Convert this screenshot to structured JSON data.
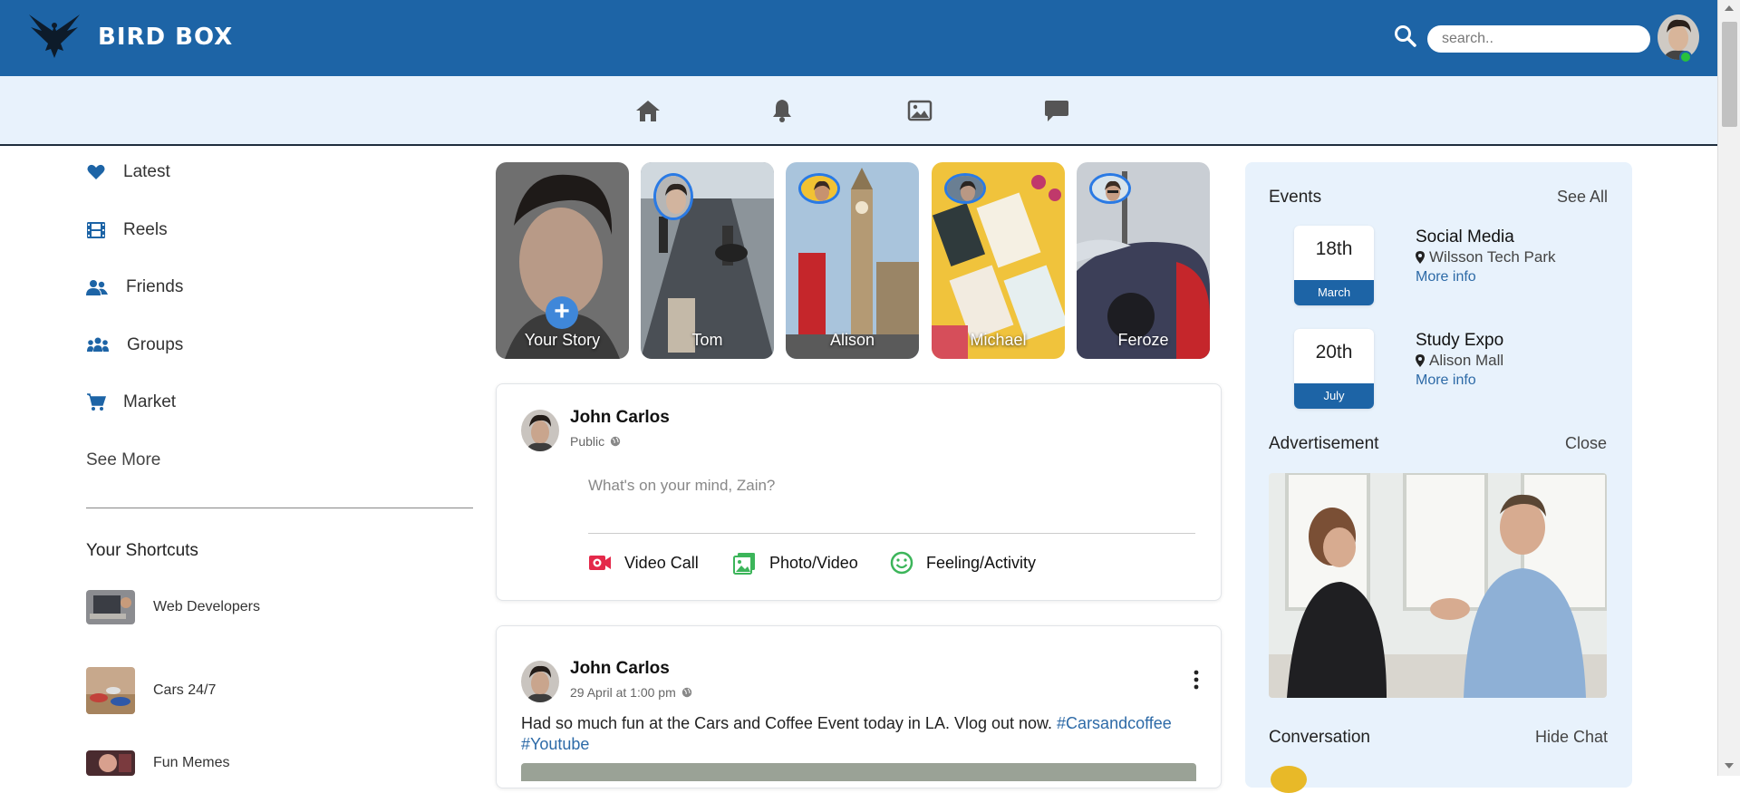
{
  "header": {
    "brand": "BIRD BOX",
    "search_placeholder": "search.."
  },
  "nav": {
    "items": [
      "home-icon",
      "bell-icon",
      "image-icon",
      "chat-icon"
    ]
  },
  "sidebar": {
    "items": [
      {
        "label": "Latest",
        "icon": "heart-icon"
      },
      {
        "label": "Reels",
        "icon": "film-icon"
      },
      {
        "label": "Friends",
        "icon": "users-icon"
      },
      {
        "label": "Groups",
        "icon": "group-icon"
      },
      {
        "label": "Market",
        "icon": "cart-icon"
      }
    ],
    "see_more": "See More",
    "shortcuts_title": "Your Shortcuts",
    "shortcuts": [
      {
        "label": "Web Developers"
      },
      {
        "label": "Cars 24/7"
      },
      {
        "label": "Fun Memes"
      }
    ]
  },
  "stories": [
    {
      "name": "Your Story"
    },
    {
      "name": "Tom"
    },
    {
      "name": "Alison"
    },
    {
      "name": "Michael"
    },
    {
      "name": "Feroze"
    }
  ],
  "composer": {
    "author": "John Carlos",
    "visibility": "Public",
    "placeholder": "What's on your mind, Zain?",
    "actions": [
      {
        "label": "Video Call",
        "icon": "video-icon",
        "color": "#e4294a"
      },
      {
        "label": "Photo/Video",
        "icon": "photo-icon",
        "color": "#3cb55a"
      },
      {
        "label": "Feeling/Activity",
        "icon": "smile-icon",
        "color": "#3cb55a"
      }
    ]
  },
  "post": {
    "author": "John Carlos",
    "time": "29 April at 1:00 pm",
    "text": "Had so much fun at the Cars and Coffee Event today in LA. Vlog out now.",
    "hashtags": [
      "#Carsandcoffee",
      "#Youtube"
    ]
  },
  "right": {
    "events_title": "Events",
    "see_all": "See All",
    "events": [
      {
        "day": "18th",
        "month": "March",
        "title": "Social Media",
        "location": "Wilsson Tech Park",
        "more": "More info"
      },
      {
        "day": "20th",
        "month": "July",
        "title": "Study Expo",
        "location": "Alison Mall",
        "more": "More info"
      }
    ],
    "ad_title": "Advertisement",
    "ad_close": "Close",
    "conversation_title": "Conversation",
    "hide_chat": "Hide Chat"
  },
  "colors": {
    "brand_blue": "#1d64a6",
    "light_panel": "#e8f2fc",
    "link_blue": "#2d6aa7",
    "online_green": "#27c23d"
  }
}
